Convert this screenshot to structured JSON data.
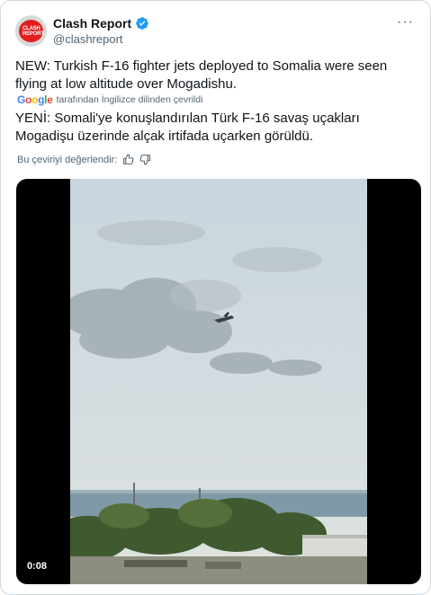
{
  "tweet": {
    "author_name": "Clash Report",
    "author_handle": "@clashreport",
    "avatar_text": "CLASH REPORT",
    "verified_color": "#1d9bf0",
    "text": "NEW: Turkish F-16 fighter jets deployed to Somalia were seen flying at low altitude over Mogadishu.",
    "more_icon": "more-horizontal-icon"
  },
  "translation": {
    "provider": "Google",
    "note": "tarafından İngilizce dilinden çevrildi",
    "text": "YENİ: Somali'ye konuşlandırılan Türk F-16 savaş uçakları Mogadişu üzerinde alçak irtifada uçarken görüldü.",
    "rate_label": "Bu çeviriyi değerlendir:",
    "thumbs_up_icon": "thumbs-up-icon",
    "thumbs_down_icon": "thumbs-down-icon"
  },
  "media": {
    "timestamp": "0:08"
  }
}
